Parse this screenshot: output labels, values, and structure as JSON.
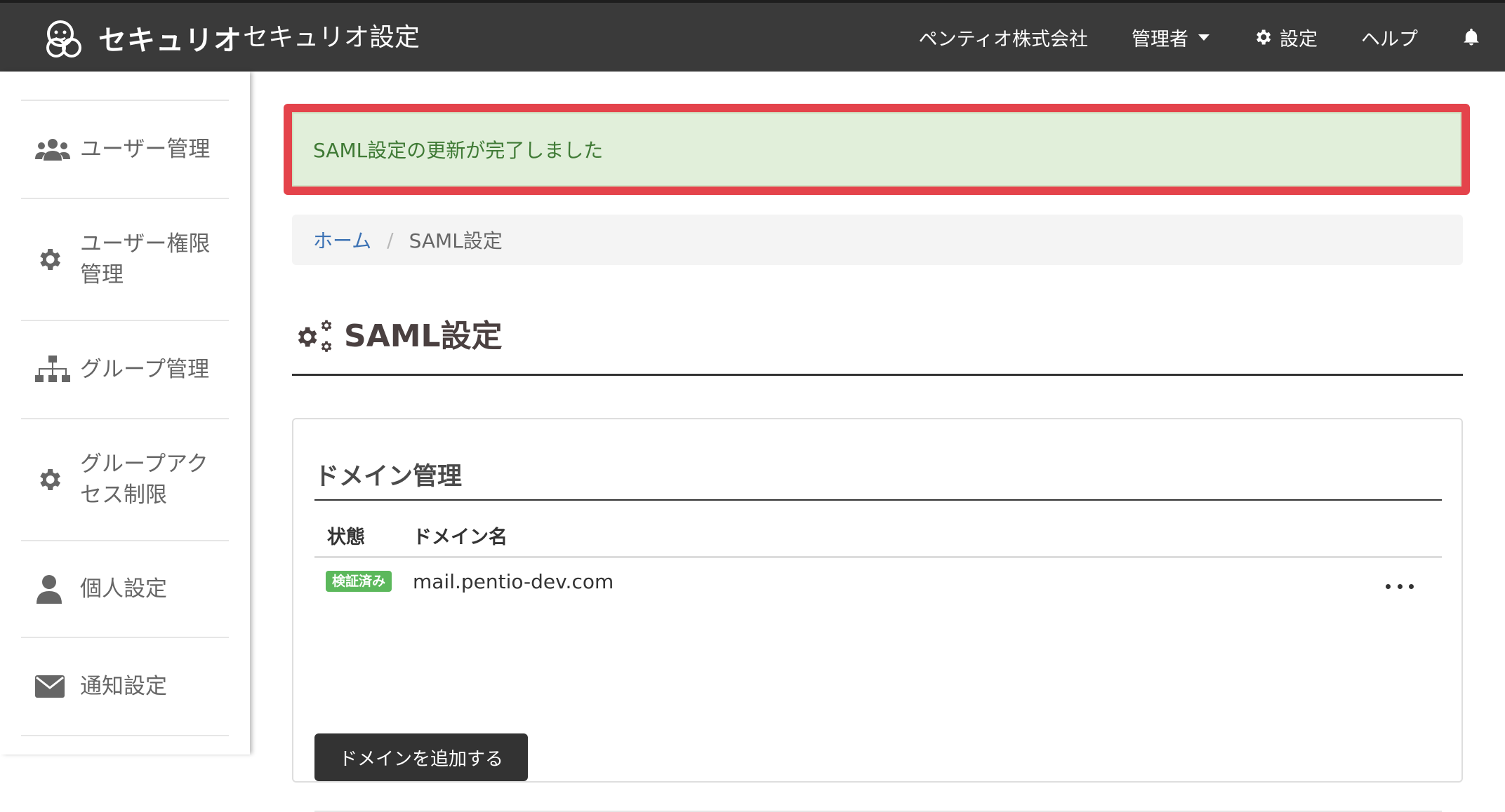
{
  "app": {
    "brand_name": "セキュリオ",
    "title": "セキュリオ設定"
  },
  "navbar": {
    "company": "ペンティオ株式会社",
    "user_menu": "管理者",
    "settings": "設定",
    "help": "ヘルプ",
    "icons": [
      "gear-icon",
      "bell-icon"
    ]
  },
  "sidebar": {
    "items": [
      {
        "label": "ユーザー管理",
        "icon": "users-icon"
      },
      {
        "label": "ユーザー権限\n管理",
        "icon": "gear-icon"
      },
      {
        "label": "グループ管理",
        "icon": "sitemap-icon"
      },
      {
        "label": "グループアク\nセス制限",
        "icon": "gear-icon"
      },
      {
        "label": "個人設定",
        "icon": "user-icon"
      },
      {
        "label": "通知設定",
        "icon": "envelope-icon"
      }
    ]
  },
  "alert": {
    "message": "SAML設定の更新が完了しました",
    "colors": {
      "frame": "#e4434b",
      "background": "#e1efda",
      "text": "#3f7a35"
    }
  },
  "breadcrumb": {
    "home": "ホーム",
    "separator": "/",
    "current": "SAML設定"
  },
  "page": {
    "title": "SAML設定",
    "icon": "gears-icon"
  },
  "domain_section": {
    "title": "ドメイン管理",
    "columns": {
      "status": "状態",
      "domain": "ドメイン名"
    },
    "rows": [
      {
        "status": "検証済み",
        "domain": "mail.pentio-dev.com"
      }
    ],
    "add_button": "ドメインを追加する"
  }
}
